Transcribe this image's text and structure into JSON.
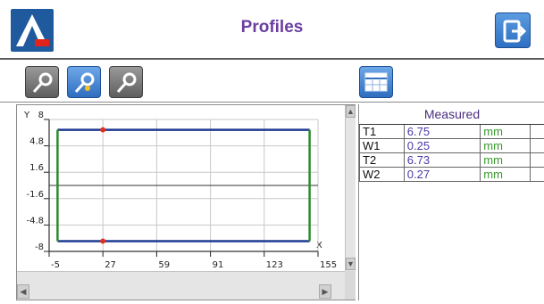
{
  "header": {
    "title": "Profiles",
    "logo_letter": "A",
    "colors": {
      "title": "#6a3fa0",
      "brand": "#1f5a9e",
      "logo_mark": "#e2231a"
    }
  },
  "toolbar": {
    "profile_buttons": [
      {
        "icon": "probe-icon",
        "active": false
      },
      {
        "icon": "probe-icon",
        "active": true
      },
      {
        "icon": "probe-icon",
        "active": false
      }
    ],
    "table_button_icon": "table-icon",
    "exit_icon": "exit-icon"
  },
  "plot": {
    "y_axis_letter": "Y",
    "x_axis_letter": "X",
    "y_ticks": [
      "8",
      "4.8",
      "1.6",
      "-1.6",
      "-4.8",
      "-8"
    ],
    "x_ticks": [
      "-5",
      "27",
      "59",
      "91",
      "123",
      "155"
    ],
    "profile": {
      "x_min": 0,
      "x_max": 150,
      "y_top": 6.75,
      "y_bottom": -6.75
    },
    "markers": [
      {
        "x": 27,
        "y": 6.75
      },
      {
        "x": 27,
        "y": -6.75
      }
    ],
    "colors": {
      "top_bottom": "#1f3a93",
      "sides": "#2e8b2e",
      "marker": "#e03020"
    }
  },
  "table": {
    "header": "Measured",
    "rows": [
      {
        "label": "T1",
        "value": "6.75",
        "unit": "mm"
      },
      {
        "label": "W1",
        "value": "0.25",
        "unit": "mm"
      },
      {
        "label": "T2",
        "value": "6.73",
        "unit": "mm"
      },
      {
        "label": "W2",
        "value": "0.27",
        "unit": "mm"
      }
    ]
  }
}
